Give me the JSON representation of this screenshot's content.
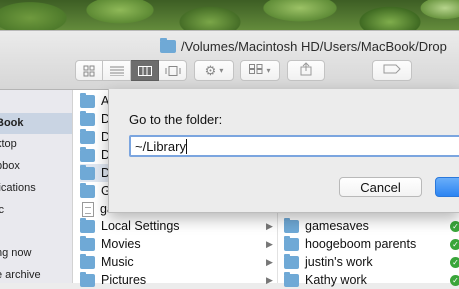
{
  "window": {
    "path_title": "/Volumes/Macintosh HD/Users/MacBook/Drop"
  },
  "toolbar": {
    "view_icon": "icon-view-icon",
    "view_list": "list-view-icon",
    "view_column": "column-view-icon",
    "view_coverflow": "coverflow-view-icon",
    "action": "gear-icon",
    "arrange": "arrange-icon",
    "share": "share-icon",
    "tags": "tag-icon"
  },
  "sidebar": {
    "items": [
      {
        "label": "Book",
        "selected": true
      },
      {
        "label": "ktop"
      },
      {
        "label": "pbox"
      },
      {
        "label": "lications"
      },
      {
        "label": "ic"
      },
      {
        "label": "ng now"
      },
      {
        "label": "e archive"
      }
    ]
  },
  "column1": {
    "partial_items": [
      "Ap",
      "De",
      "De",
      "Do",
      "Dr",
      "Ga",
      "ga"
    ],
    "items": [
      "Local Settings",
      "Movies",
      "Music",
      "Pictures"
    ]
  },
  "column2": {
    "items": [
      "gamesaves",
      "hoogeboom parents",
      "justin's work",
      "Kathy work"
    ]
  },
  "dialog": {
    "label": "Go to the folder:",
    "input_value": "~/Library",
    "cancel_label": "Cancel",
    "go_label": ""
  },
  "colors": {
    "accent": "#2c84f2",
    "sync_check": "#3aa53a",
    "folder": "#6fa9d6"
  }
}
